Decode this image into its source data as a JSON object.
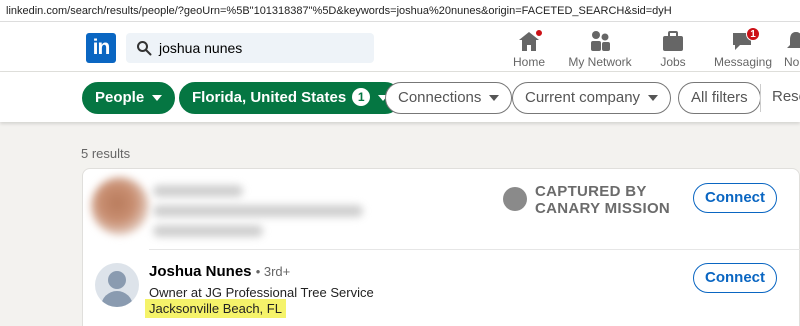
{
  "browser": {
    "url": "linkedin.com/search/results/people/?geoUrn=%5B\"101318387\"%5D&keywords=joshua%20nunes&origin=FACETED_SEARCH&sid=dyH"
  },
  "header": {
    "logo": "in",
    "search_value": "joshua nunes",
    "nav": [
      {
        "label": "Home",
        "icon": "home-icon"
      },
      {
        "label": "My Network",
        "icon": "network-icon"
      },
      {
        "label": "Jobs",
        "icon": "jobs-icon"
      },
      {
        "label": "Messaging",
        "icon": "messaging-icon",
        "badge": "1"
      },
      {
        "label": "No",
        "icon": "notifications-icon"
      }
    ]
  },
  "filters": {
    "people": "People",
    "location": "Florida, United States",
    "location_count": "1",
    "connections": "Connections",
    "current_company": "Current company",
    "all_filters": "All filters",
    "reset": "Rese"
  },
  "results": {
    "count_text": "5 results",
    "watermark_line1": "CAPTURED BY",
    "watermark_line2": "CANARY MISSION",
    "connect_label": "Connect",
    "person": {
      "name": "Joshua Nunes",
      "degree": "• 3rd+",
      "headline": "Owner at JG Professional Tree Service",
      "location": "Jacksonville Beach, FL"
    }
  },
  "colors": {
    "brand": "#0a66c2",
    "filter_active": "#057642",
    "highlight": "#f5f36a"
  }
}
